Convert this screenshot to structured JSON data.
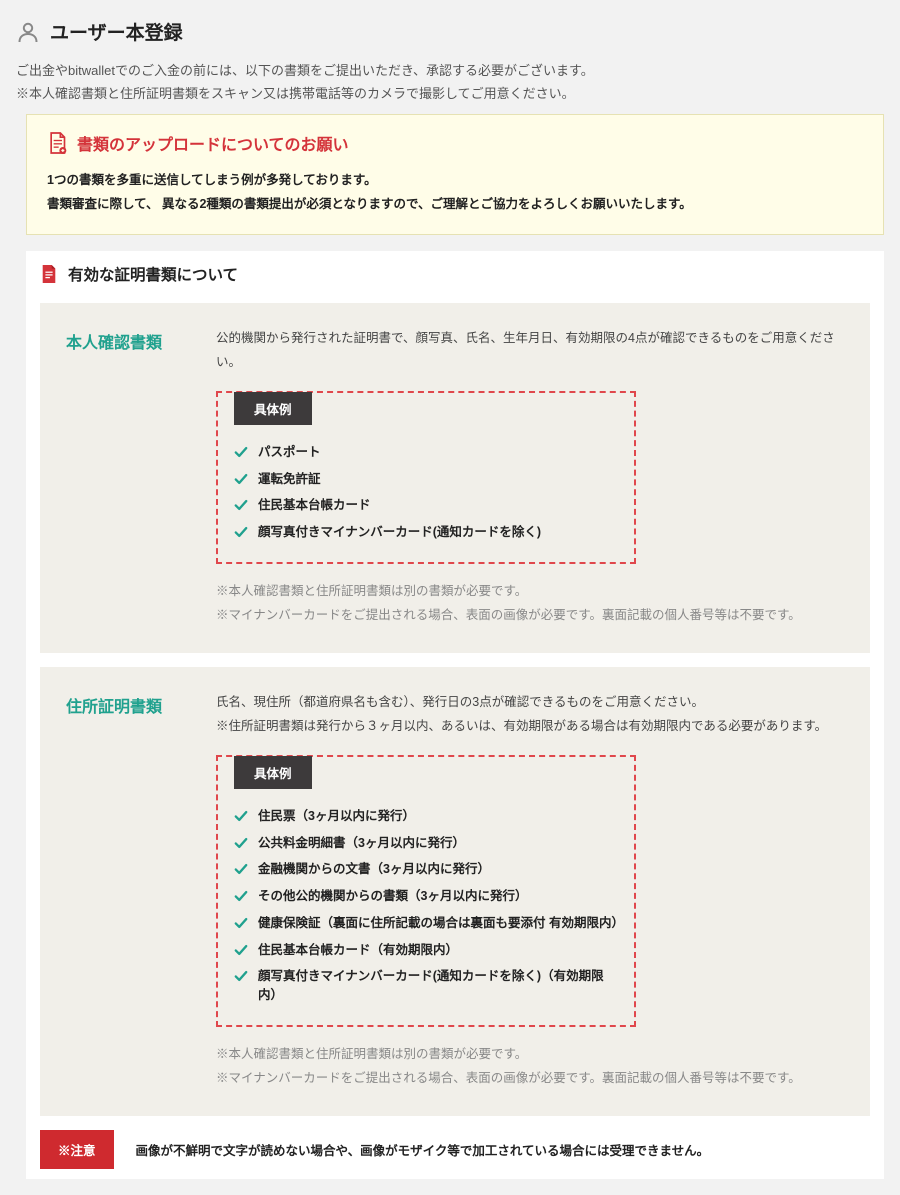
{
  "header": {
    "title": "ユーザー本登録"
  },
  "intro": {
    "line1": "ご出金やbitwalletでのご入金の前には、以下の書類をご提出いただき、承認する必要がございます。",
    "line2": "※本人確認書類と住所証明書類をスキャン又は携帯電話等のカメラで撮影してご用意ください。"
  },
  "notice": {
    "title": "書類のアップロードについてのお願い",
    "body1": "1つの書類を多重に送信してしまう例が多発しております。",
    "body2": "書類審査に際して、 異なる2種類の書類提出が必須となりますので、ご理解とご協力をよろしくお願いいたします。"
  },
  "section": {
    "title": "有効な証明書類について"
  },
  "identity": {
    "heading": "本人確認書類",
    "desc": "公的機関から発行された証明書で、顔写真、氏名、生年月日、有効期限の4点が確認できるものをご用意ください。",
    "example_label": "具体例",
    "items": [
      "パスポート",
      "運転免許証",
      "住民基本台帳カード",
      "顔写真付きマイナンバーカード(通知カードを除く)"
    ],
    "note1": "※本人確認書類と住所証明書類は別の書類が必要です。",
    "note2": "※マイナンバーカードをご提出される場合、表面の画像が必要です。裏面記載の個人番号等は不要です。"
  },
  "address": {
    "heading": "住所証明書類",
    "desc1": "氏名、現住所（都道府県名も含む）、発行日の3点が確認できるものをご用意ください。",
    "desc2": "※住所証明書類は発行から３ヶ月以内、あるいは、有効期限がある場合は有効期限内である必要があります。",
    "example_label": "具体例",
    "items": [
      "住民票（3ヶ月以内に発行）",
      "公共料金明細書（3ヶ月以内に発行）",
      "金融機関からの文書（3ヶ月以内に発行）",
      "その他公的機関からの書類（3ヶ月以内に発行）",
      "健康保険証（裏面に住所記載の場合は裏面も要添付 有効期限内）",
      "住民基本台帳カード（有効期限内）",
      "顔写真付きマイナンバーカード(通知カードを除く)（有効期限内）"
    ],
    "note1": "※本人確認書類と住所証明書類は別の書類が必要です。",
    "note2": "※マイナンバーカードをご提出される場合、表面の画像が必要です。裏面記載の個人番号等は不要です。"
  },
  "footer": {
    "tag": "※注意",
    "text": "画像が不鮮明で文字が読めない場合や、画像がモザイク等で加工されている場合には受理できません。"
  }
}
